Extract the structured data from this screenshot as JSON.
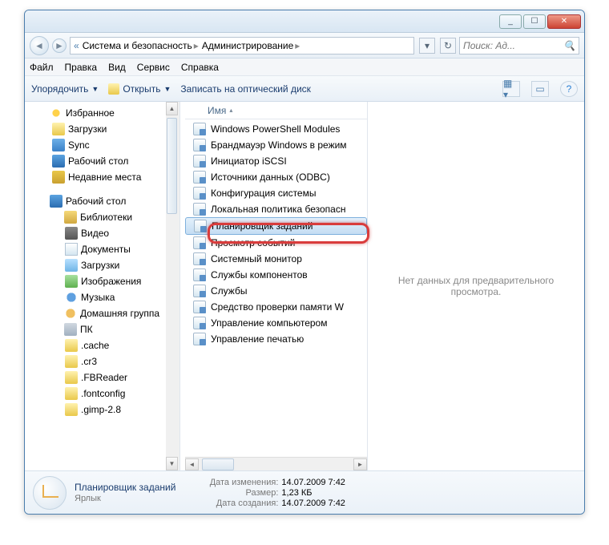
{
  "titlebar": {
    "min": "_",
    "max": "☐",
    "close": "✕"
  },
  "nav": {
    "breadcrumb_root_icon": "«",
    "crumbs": [
      "Система и безопасность",
      "Администрирование"
    ],
    "search_placeholder": "Поиск: Ад..."
  },
  "menu": {
    "file": "Файл",
    "edit": "Правка",
    "view": "Вид",
    "tools": "Сервис",
    "help": "Справка"
  },
  "toolbar": {
    "organize": "Упорядочить",
    "open": "Открыть",
    "burn": "Записать на оптический диск"
  },
  "sidebar": {
    "favorites": "Избранное",
    "downloads": "Загрузки",
    "sync": "Sync",
    "desktop": "Рабочий стол",
    "recent": "Недавние места",
    "desktop_root": "Рабочий стол",
    "libraries": "Библиотеки",
    "video": "Видео",
    "documents": "Документы",
    "lib_downloads": "Загрузки",
    "images": "Изображения",
    "music": "Музыка",
    "homegroup": "Домашняя группа",
    "pc": "ПК",
    "cache": ".cache",
    "cr3": ".cr3",
    "fbreader": ".FBReader",
    "fontconfig": ".fontconfig",
    "gimp": ".gimp-2.8"
  },
  "list": {
    "header": "Имя",
    "items": [
      "Windows PowerShell Modules",
      "Брандмауэр Windows в режим",
      "Инициатор iSCSI",
      "Источники данных (ODBC)",
      "Конфигурация системы",
      "Локальная политика безопасн",
      "Планировщик заданий",
      "Просмотр событий",
      "Системный монитор",
      "Службы компонентов",
      "Службы",
      "Средство проверки памяти W",
      "Управление компьютером",
      "Управление печатью"
    ],
    "selected_index": 6
  },
  "preview": {
    "empty": "Нет данных для предварительного просмотра."
  },
  "details": {
    "title": "Планировщик заданий",
    "type": "Ярлык",
    "modified_label": "Дата изменения:",
    "modified_value": "14.07.2009 7:42",
    "size_label": "Размер:",
    "size_value": "1,23 КБ",
    "created_label": "Дата создания:",
    "created_value": "14.07.2009 7:42"
  }
}
